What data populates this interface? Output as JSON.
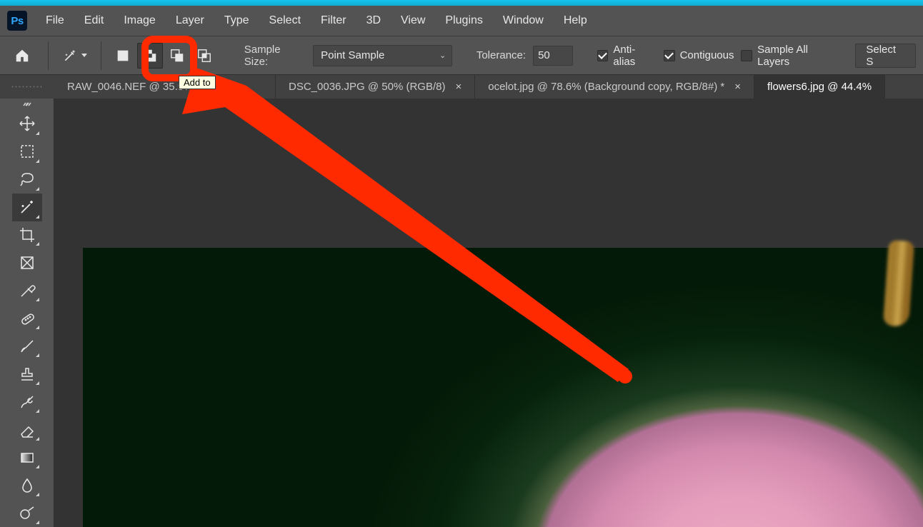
{
  "menu": [
    "File",
    "Edit",
    "Image",
    "Layer",
    "Type",
    "Select",
    "Filter",
    "3D",
    "View",
    "Plugins",
    "Window",
    "Help"
  ],
  "options": {
    "sample_size_label": "Sample Size:",
    "sample_size_value": "Point Sample",
    "tolerance_label": "Tolerance:",
    "tolerance_value": "50",
    "anti_alias": "Anti-alias",
    "contiguous": "Contiguous",
    "sample_all_layers": "Sample All Layers",
    "select_subject": "Select S"
  },
  "tabs": [
    {
      "label": "RAW_0046.NEF @ 35.5% (R"
    },
    {
      "label": "DSC_0036.JPG @ 50% (RGB/8)"
    },
    {
      "label": "ocelot.jpg @ 78.6% (Background copy, RGB/8#) *"
    },
    {
      "label": "flowers6.jpg @ 44.4%"
    }
  ],
  "tooltip": "Add to"
}
